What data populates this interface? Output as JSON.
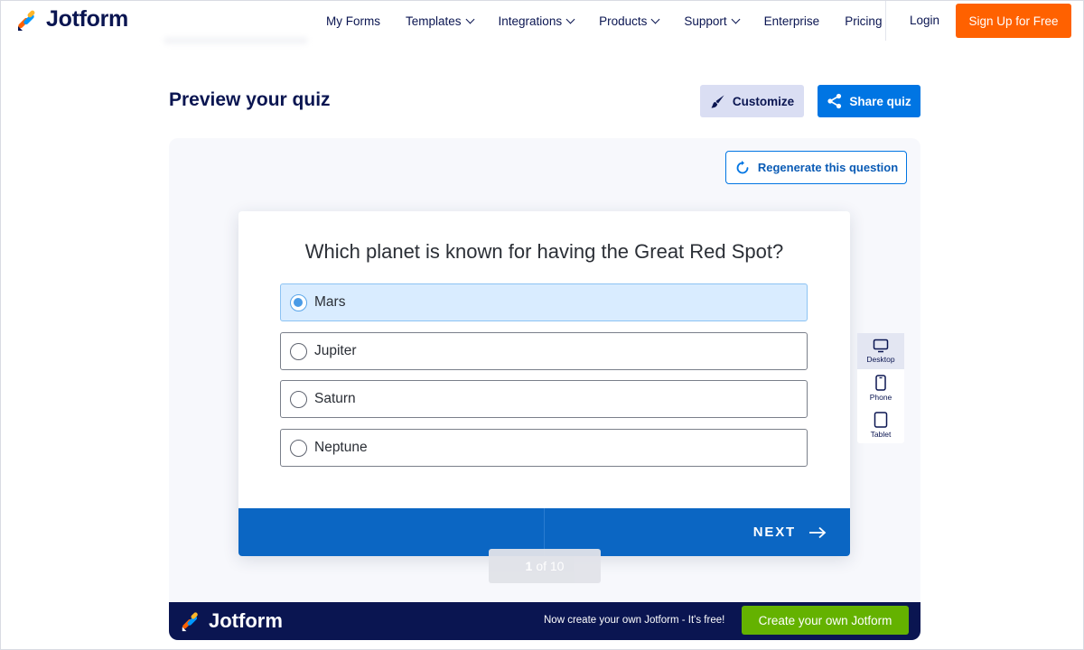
{
  "brand": {
    "name": "Jotform"
  },
  "nav": {
    "items": [
      {
        "label": "My Forms",
        "dropdown": false
      },
      {
        "label": "Templates",
        "dropdown": true
      },
      {
        "label": "Integrations",
        "dropdown": true
      },
      {
        "label": "Products",
        "dropdown": true
      },
      {
        "label": "Support",
        "dropdown": true
      },
      {
        "label": "Enterprise",
        "dropdown": false
      },
      {
        "label": "Pricing",
        "dropdown": false
      }
    ],
    "login": "Login",
    "signup": "Sign Up for Free"
  },
  "header": {
    "title": "Preview your quiz",
    "customize": "Customize",
    "share": "Share quiz"
  },
  "preview": {
    "regenerate": "Regenerate this question",
    "question": "Which planet is known for having the Great Red Spot?",
    "options": [
      {
        "label": "Mars",
        "selected": true
      },
      {
        "label": "Jupiter",
        "selected": false
      },
      {
        "label": "Saturn",
        "selected": false
      },
      {
        "label": "Neptune",
        "selected": false
      }
    ],
    "next": "NEXT",
    "pager": {
      "current": "1",
      "of": "of 10"
    },
    "devices": [
      {
        "label": "Desktop",
        "icon": "desktop-icon",
        "active": true
      },
      {
        "label": "Phone",
        "icon": "phone-icon",
        "active": false
      },
      {
        "label": "Tablet",
        "icon": "tablet-icon",
        "active": false
      }
    ]
  },
  "banner": {
    "brand": "Jotform",
    "text": "Now create your own Jotform - It's free!",
    "button": "Create your own Jotform"
  },
  "colors": {
    "accent": "#0075e3",
    "signup": "#ff6100",
    "navy": "#0a1551",
    "green": "#64b200"
  }
}
